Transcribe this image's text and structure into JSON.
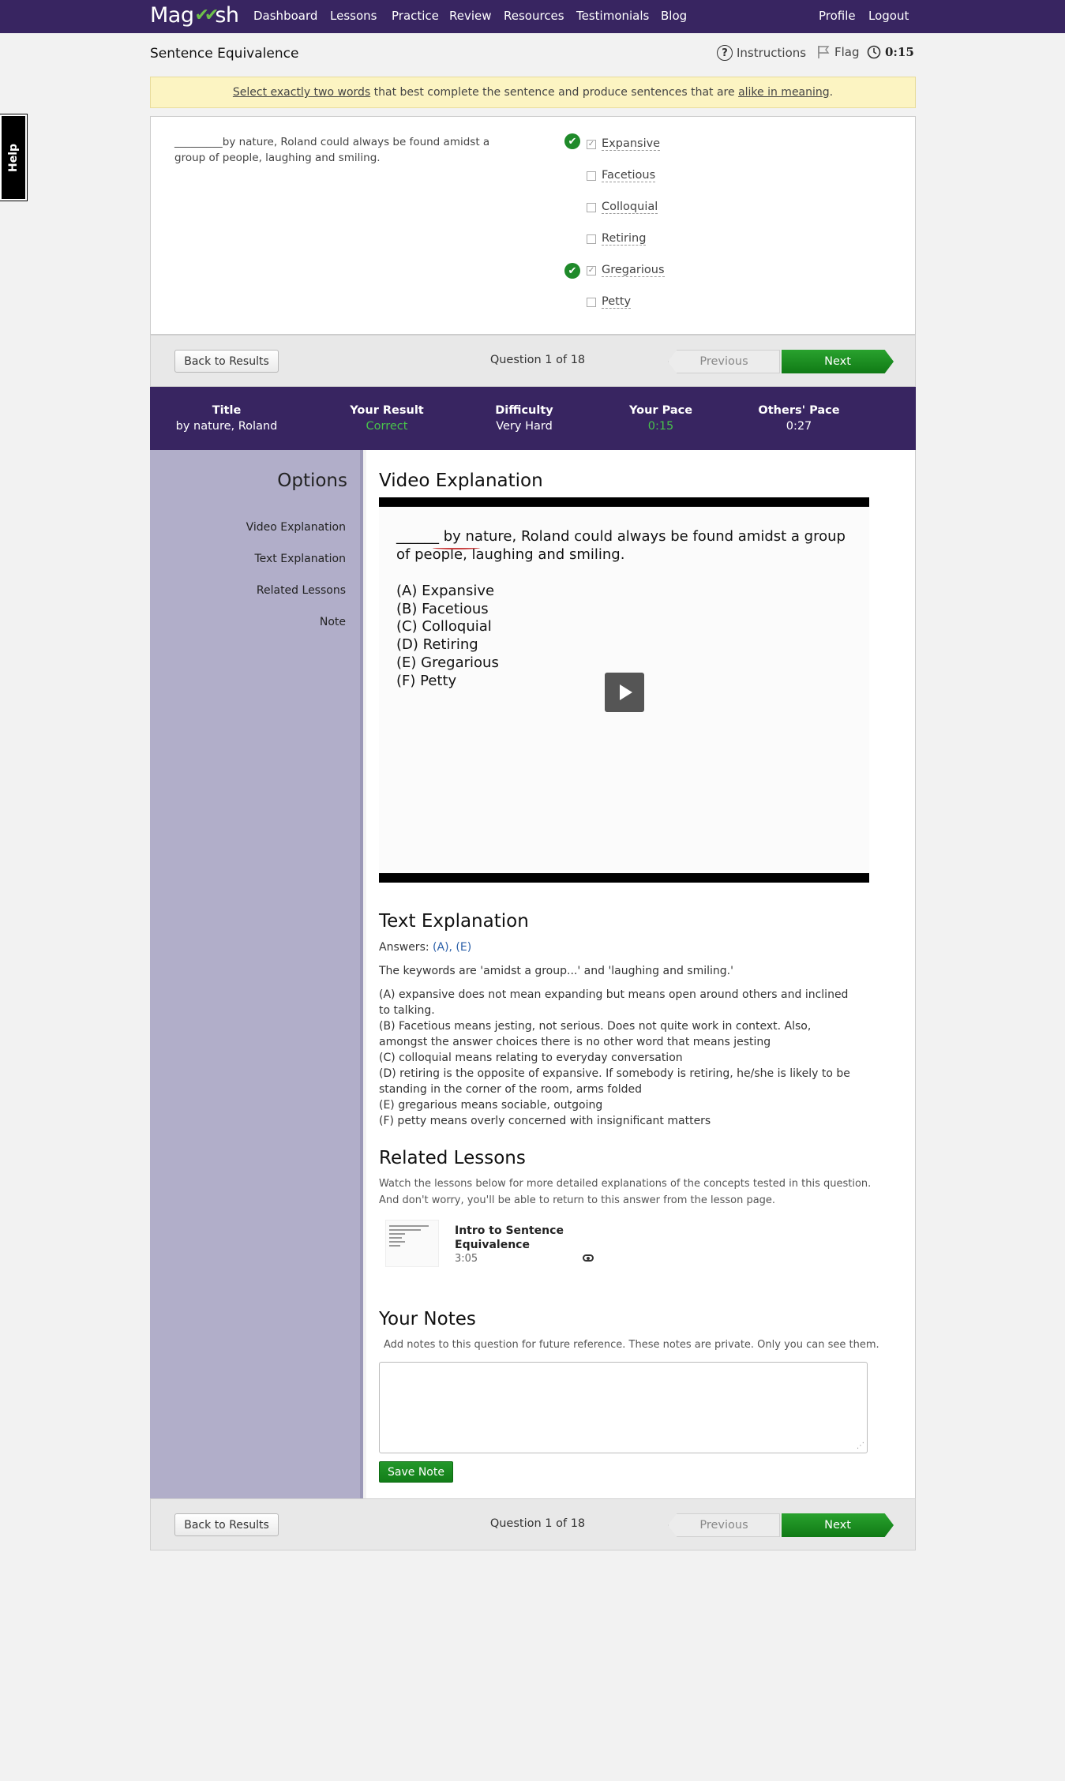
{
  "nav": {
    "logo_left": "Mag",
    "logo_right": "sh",
    "links": [
      "Dashboard",
      "Lessons",
      "Practice",
      "Review",
      "Resources",
      "Testimonials",
      "Blog"
    ],
    "profile": "Profile",
    "logout": "Logout"
  },
  "header": {
    "title": "Sentence Equivalence",
    "instructions": "Instructions",
    "flag": "Flag",
    "timer": "0:15"
  },
  "instruction": {
    "part1": "Select exactly two words",
    "part2": " that best complete the sentence and produce sentences that are ",
    "part3": "alike in meaning",
    "part4": "."
  },
  "question": {
    "text": "_________by nature, Roland could always be found amidst a group of people, laughing and smiling.",
    "choices": [
      {
        "label": "Expansive",
        "checked": true
      },
      {
        "label": "Facetious",
        "checked": false
      },
      {
        "label": "Colloquial",
        "checked": false
      },
      {
        "label": "Retiring",
        "checked": false
      },
      {
        "label": "Gregarious",
        "checked": true
      },
      {
        "label": "Petty",
        "checked": false
      }
    ]
  },
  "navigation": {
    "back": "Back to Results",
    "count": "Question 1 of 18",
    "previous": "Previous",
    "next": "Next"
  },
  "stats": {
    "title_label": "Title",
    "title_value": "by nature, Roland",
    "result_label": "Your Result",
    "result_value": "Correct",
    "difficulty_label": "Difficulty",
    "difficulty_value": "Very Hard",
    "pace_label": "Your Pace",
    "pace_value": "0:15",
    "others_label": "Others' Pace",
    "others_value": "0:27"
  },
  "sidebar": {
    "title": "Options",
    "items": [
      "Video Explanation",
      "Text Explanation",
      "Related Lessons",
      "Note"
    ]
  },
  "video": {
    "title": "Video Explanation",
    "sentence": "______ by nature, Roland could always be found amidst a group of people, laughing and smiling.",
    "options": [
      "(A) Expansive",
      "(B) Facetious",
      "(C) Colloquial",
      "(D) Retiring",
      "(E) Gregarious",
      "(F) Petty"
    ]
  },
  "text_explanation": {
    "title": "Text Explanation",
    "answers_prefix": "Answers: ",
    "answers_value": "(A), (E)",
    "keywords": "The keywords are 'amidst a group...' and 'laughing and smiling.'",
    "lines": [
      "(A) expansive does not mean expanding but means open around others and inclined to talking.",
      "(B) Facetious means jesting, not serious. Does not quite work in context. Also, amongst the answer choices there is no other word that means jesting",
      "(C) colloquial means relating to everyday conversation",
      "(D) retiring is the opposite of expansive. If somebody is retiring, he/she is likely to be standing in the corner of the room, arms folded",
      "(E) gregarious means sociable, outgoing",
      "(F) petty means overly concerned with insignificant matters"
    ]
  },
  "related": {
    "title": "Related Lessons",
    "desc1": "Watch the lessons below for more detailed explanations of the concepts tested in this question.",
    "desc2": "And don't worry, you'll be able to return to this answer from the lesson page.",
    "lesson_title": "Intro to Sentence Equivalence",
    "lesson_duration": "3:05"
  },
  "notes": {
    "title": "Your Notes",
    "desc": "Add notes to this question for future reference. These notes are private. Only you can see them.",
    "value": "",
    "save": "Save Note"
  },
  "help": "Help"
}
